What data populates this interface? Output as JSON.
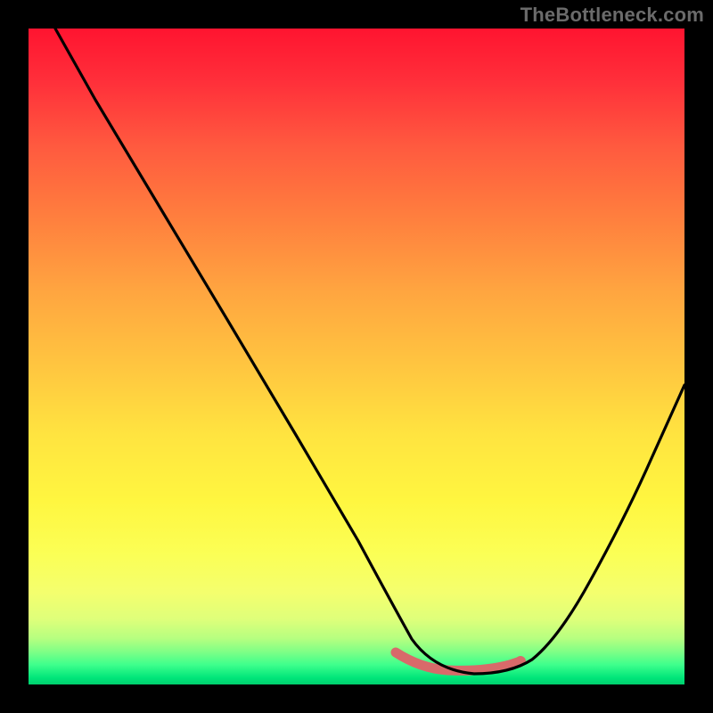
{
  "watermark": "TheBottleneck.com",
  "chart_data": {
    "type": "line",
    "title": "",
    "xlabel": "",
    "ylabel": "",
    "xlim": [
      0,
      100
    ],
    "ylim": [
      0,
      100
    ],
    "grid": false,
    "legend": false,
    "background": {
      "gradient_stops": [
        {
          "pos": 0.0,
          "color": "#ff1430",
          "meaning": "worst"
        },
        {
          "pos": 0.5,
          "color": "#ffc03e"
        },
        {
          "pos": 0.8,
          "color": "#fcff55"
        },
        {
          "pos": 1.0,
          "color": "#00cf6e",
          "meaning": "best"
        }
      ]
    },
    "series": [
      {
        "name": "bottleneck-curve",
        "color": "#000000",
        "x": [
          4,
          10,
          20,
          30,
          40,
          50,
          56,
          60,
          64,
          68,
          72,
          76,
          80,
          86,
          92,
          100
        ],
        "y": [
          100,
          89,
          72,
          55,
          38,
          21,
          11,
          5,
          1,
          0,
          0,
          0,
          2,
          10,
          22,
          42
        ]
      }
    ],
    "highlight": {
      "name": "optimal-range",
      "color": "#d86a6a",
      "x_range": [
        56,
        75
      ],
      "y": 3
    }
  }
}
